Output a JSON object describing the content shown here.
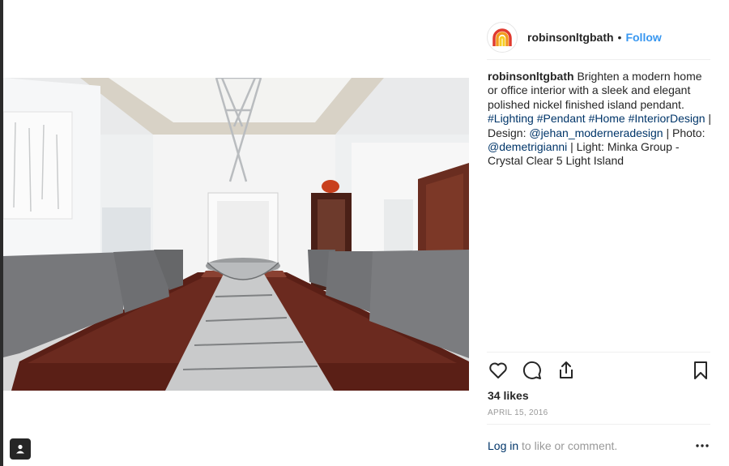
{
  "header": {
    "username": "robinsonltgbath",
    "separator": "•",
    "follow_label": "Follow"
  },
  "caption": {
    "username": "robinsonltgbath",
    "text": "Brighten a modern home or office interior with a sleek and elegant polished nickel finished island pendant.",
    "hashtags": [
      "#Lighting",
      "#Pendant",
      "#Home",
      "#InteriorDesign"
    ],
    "design_prefix": "| Design:",
    "design_mention": "@jehan_moderneradesign",
    "photo_prefix": "| Photo:",
    "photo_mention": "@demetrigianni",
    "light_text": "| Light: Minka Group - Crystal Clear 5 Light Island"
  },
  "actions": {
    "like_icon": "heart-icon",
    "comment_icon": "comment-icon",
    "share_icon": "share-icon",
    "save_icon": "bookmark-icon"
  },
  "likes_text": "34 likes",
  "date": "APRIL 15, 2016",
  "login": {
    "link": "Log in",
    "rest": "to like or comment."
  },
  "more_label": "•••",
  "colors": {
    "follow_blue": "#3897f0",
    "link_navy": "#003569",
    "muted_gray": "#999999",
    "text_dark": "#262626"
  }
}
